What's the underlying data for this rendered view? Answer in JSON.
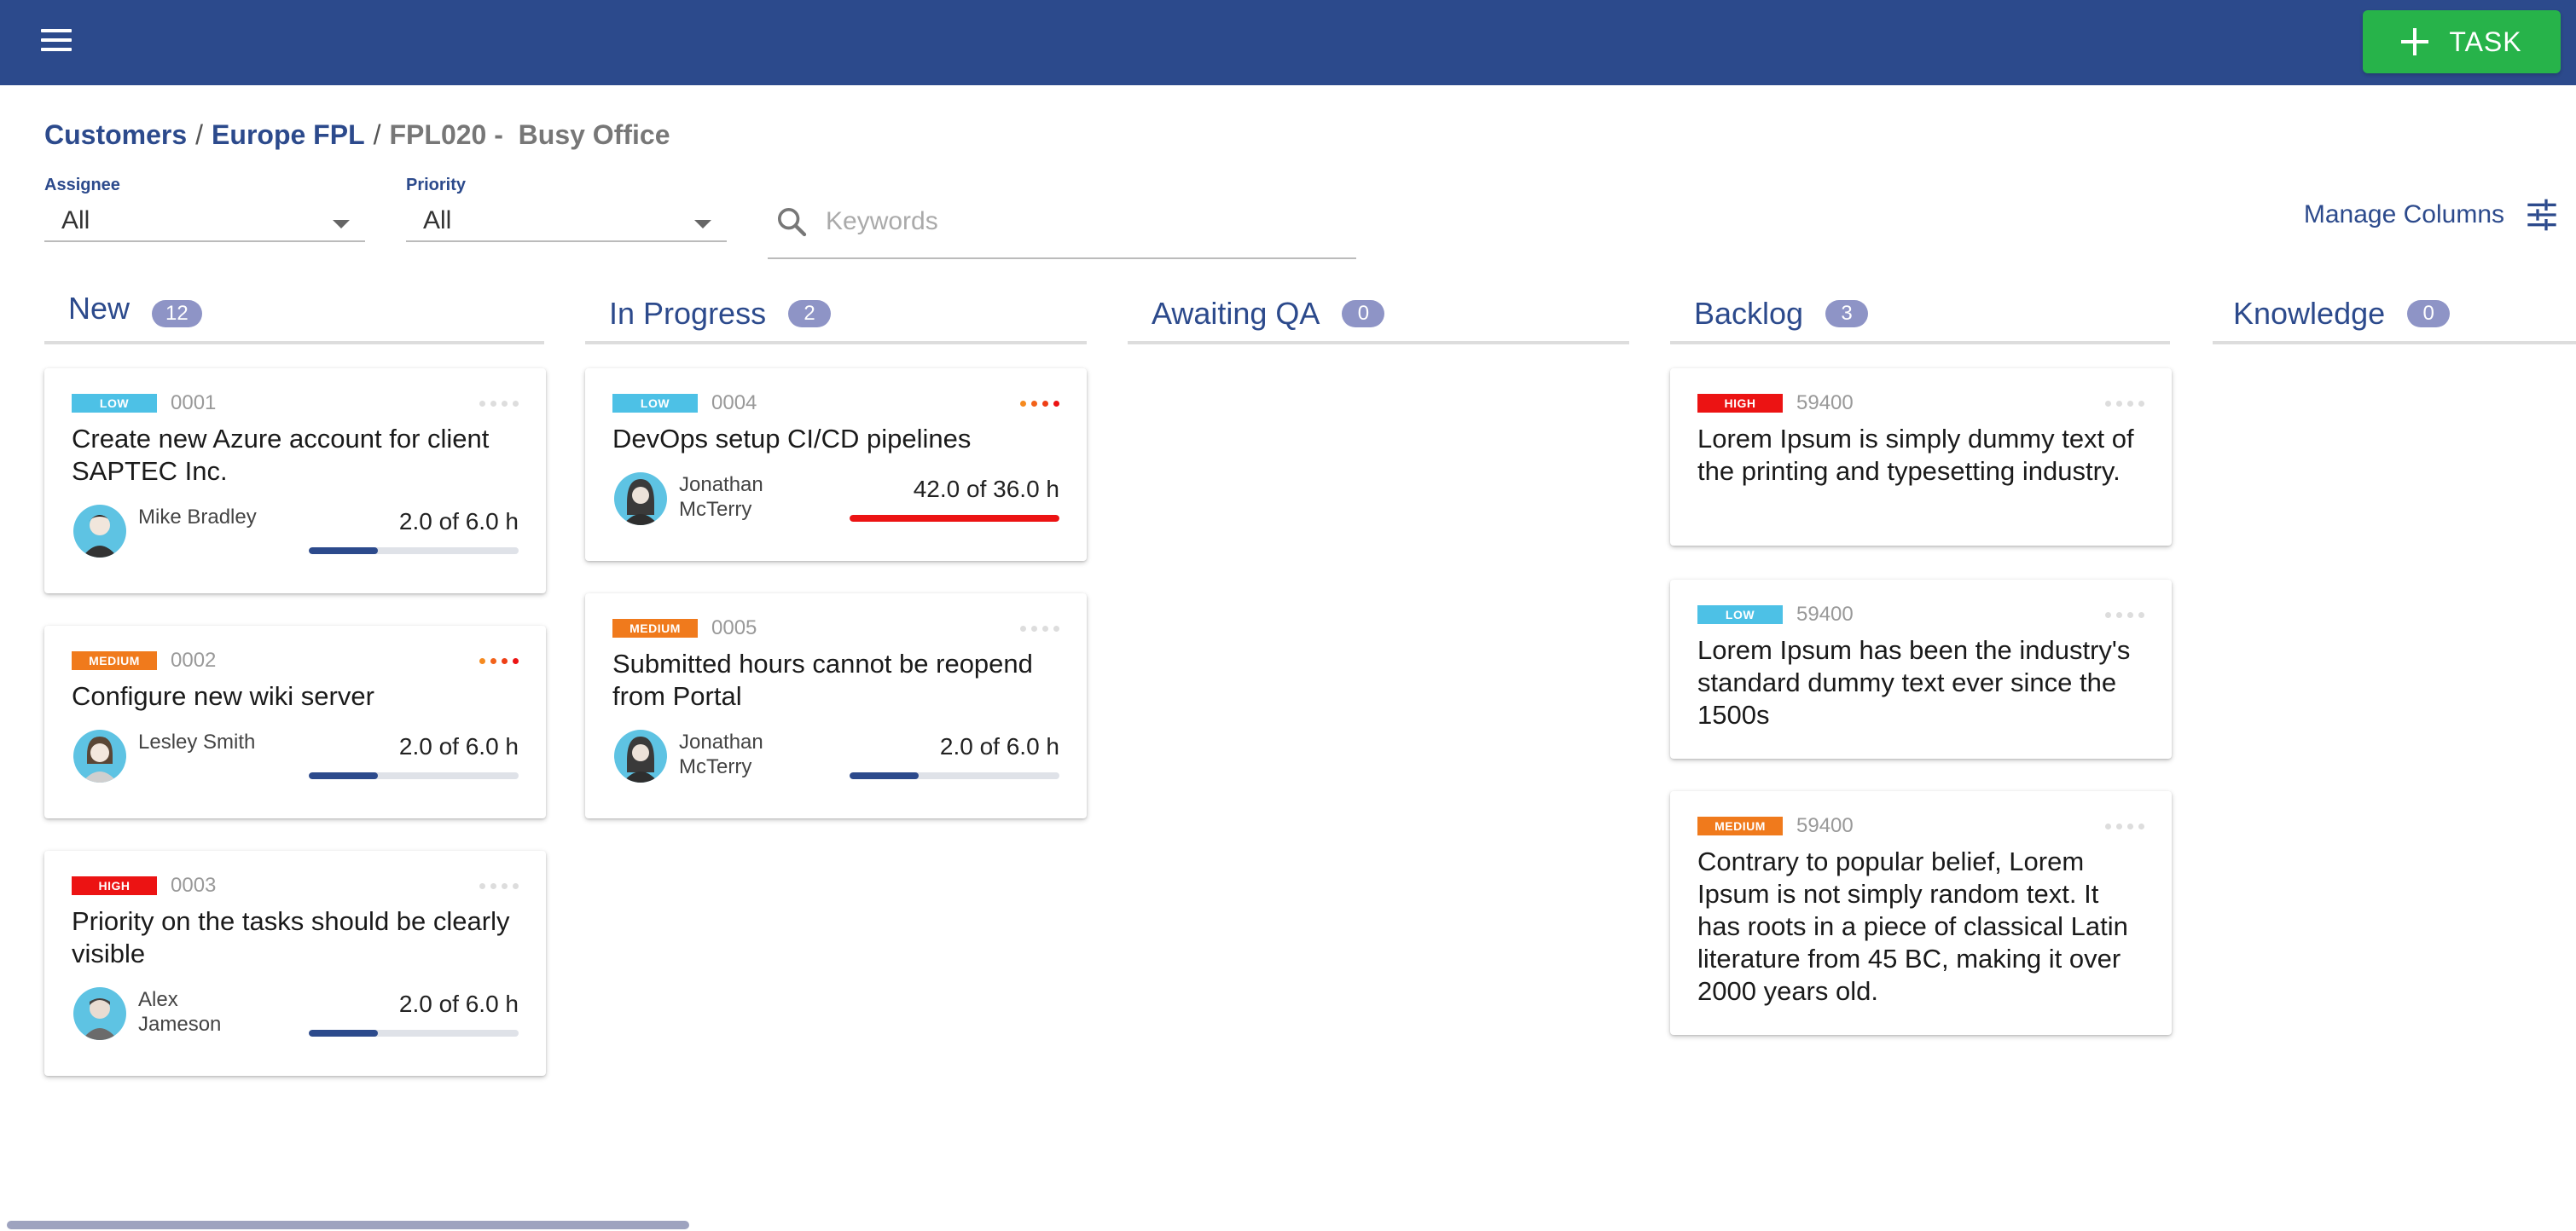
{
  "toolbar": {
    "task_button_label": "TASK"
  },
  "breadcrumb": {
    "items": [
      "Customers",
      "Europe FPL"
    ],
    "current": "FPL020 -  Busy Office",
    "separator": "/"
  },
  "filters": {
    "assignee": {
      "label": "Assignee",
      "value": "All"
    },
    "priority": {
      "label": "Priority",
      "value": "All"
    },
    "search": {
      "placeholder": "Keywords",
      "value": ""
    },
    "manage_columns_label": "Manage Columns"
  },
  "columns": [
    {
      "title": "New",
      "count": "12"
    },
    {
      "title": "In Progress",
      "count": "2"
    },
    {
      "title": "Awaiting QA",
      "count": "0"
    },
    {
      "title": "Backlog",
      "count": "3"
    },
    {
      "title": "Knowledge",
      "count": "0"
    }
  ],
  "cards": {
    "c0001": {
      "priority": "LOW",
      "id": "0001",
      "title": "Create new Azure account for client SAPTEC Inc.",
      "assignee": "Mike Bradley",
      "hours": "2.0 of 6.0 h",
      "progress": 0.33,
      "flagged": false
    },
    "c0002": {
      "priority": "MEDIUM",
      "id": "0002",
      "title": "Configure new wiki server",
      "assignee": "Lesley Smith",
      "hours": "2.0 of 6.0 h",
      "progress": 0.33,
      "flagged": true
    },
    "c0003": {
      "priority": "HIGH",
      "id": "0003",
      "title": "Priority on the tasks should be clearly visible",
      "assignee": "Alex Jameson",
      "hours": "2.0 of 6.0 h",
      "progress": 0.33,
      "flagged": false
    },
    "c0004": {
      "priority": "LOW",
      "id": "0004",
      "title": "DevOps setup CI/CD pipelines",
      "assignee": "Jonathan McTerry",
      "hours": "42.0 of 36.0 h",
      "progress": 1.0,
      "flagged": true
    },
    "c0005": {
      "priority": "MEDIUM",
      "id": "0005",
      "title": "Submitted hours cannot be reopend from Portal",
      "assignee": "Jonathan McTerry",
      "hours": "2.0 of 6.0 h",
      "progress": 0.33,
      "flagged": false
    },
    "b1": {
      "priority": "HIGH",
      "id": "59400",
      "title": "Lorem Ipsum is simply dummy text of the printing and typesetting industry."
    },
    "b2": {
      "priority": "LOW",
      "id": "59400",
      "title": "Lorem Ipsum has been the industry's standard dummy text ever since the 1500s"
    },
    "b3": {
      "priority": "MEDIUM",
      "id": "59400",
      "title": "Contrary to popular belief, Lorem Ipsum is not simply random text. It has roots in a piece of classical Latin literature from 45 BC, making it over 2000 years old."
    }
  },
  "colors": {
    "topbar": "#2c4a8c",
    "task_button": "#27b34a",
    "low": "#4dc1e6",
    "medium": "#f07a1c",
    "high": "#ec1313"
  }
}
